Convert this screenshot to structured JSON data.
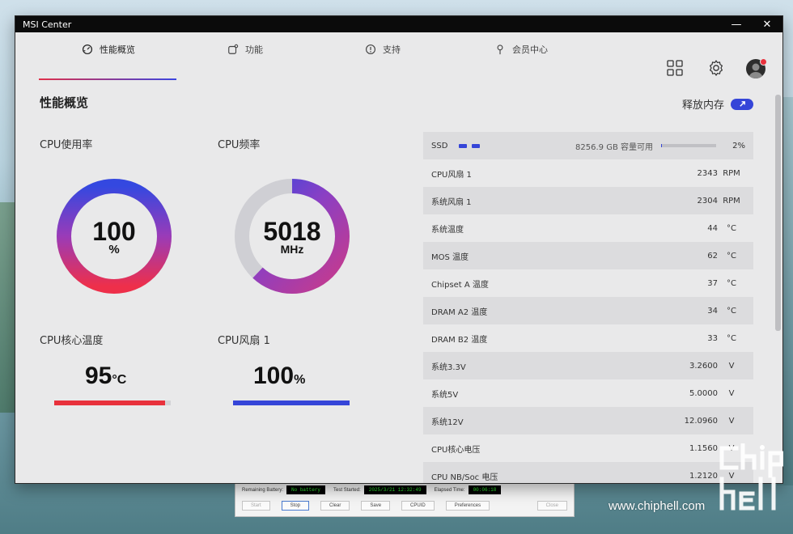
{
  "window": {
    "title": "MSI Center",
    "minimize": "—",
    "close": "✕"
  },
  "tabs": [
    {
      "label": "性能概览",
      "icon": "gauge-icon"
    },
    {
      "label": "功能",
      "icon": "features-icon"
    },
    {
      "label": "支持",
      "icon": "support-icon"
    },
    {
      "label": "会员中心",
      "icon": "member-icon"
    }
  ],
  "page": {
    "title": "性能概览",
    "release_memory": "释放内存"
  },
  "gauges": {
    "cpu_usage": {
      "label": "CPU使用率",
      "value": "100",
      "unit": "%",
      "fraction": 1.0
    },
    "cpu_freq": {
      "label": "CPU频率",
      "value": "5018",
      "unit": "MHz",
      "fraction": 0.62
    },
    "cpu_temp": {
      "label": "CPU核心温度",
      "value": "95",
      "unit": "°C",
      "fraction": 0.95
    },
    "cpu_fan": {
      "label": "CPU风扇 1",
      "value": "100",
      "unit": "%",
      "fraction": 1.0
    }
  },
  "ssd": {
    "name": "SSD",
    "capacity": "8256.9 GB 容量可用",
    "percent": "2%",
    "fraction": 0.02
  },
  "sensors": [
    {
      "name": "CPU风扇 1",
      "value": "2343",
      "unit": "RPM"
    },
    {
      "name": "系统风扇 1",
      "value": "2304",
      "unit": "RPM"
    },
    {
      "name": "系统温度",
      "value": "44",
      "unit": "°C"
    },
    {
      "name": "MOS 温度",
      "value": "62",
      "unit": "°C"
    },
    {
      "name": "Chipset A 温度",
      "value": "37",
      "unit": "°C"
    },
    {
      "name": "DRAM A2 温度",
      "value": "34",
      "unit": "°C"
    },
    {
      "name": "DRAM B2 温度",
      "value": "33",
      "unit": "°C"
    },
    {
      "name": "系统3.3V",
      "value": "3.2600",
      "unit": "V"
    },
    {
      "name": "系统5V",
      "value": "5.0000",
      "unit": "V"
    },
    {
      "name": "系统12V",
      "value": "12.0960",
      "unit": "V"
    },
    {
      "name": "CPU核心电压",
      "value": "1.1560",
      "unit": "V"
    },
    {
      "name": "CPU NB/Soc 电压",
      "value": "1.2120",
      "unit": "V"
    }
  ],
  "test_window": {
    "remaining_battery_label": "Remaining Battery:",
    "remaining_battery": "No battery",
    "test_started_label": "Test Started:",
    "test_started": "2025/3/21 12:32:49",
    "elapsed_label": "Elapsed Time:",
    "elapsed": "00:06:18",
    "buttons": [
      "Start",
      "Stop",
      "Clear",
      "Save",
      "CPUID",
      "Preferences",
      "Close"
    ]
  },
  "watermark": {
    "url": "www.chiphell.com"
  },
  "colors": {
    "accent_blue": "#3545d8",
    "accent_red": "#e8313c"
  }
}
